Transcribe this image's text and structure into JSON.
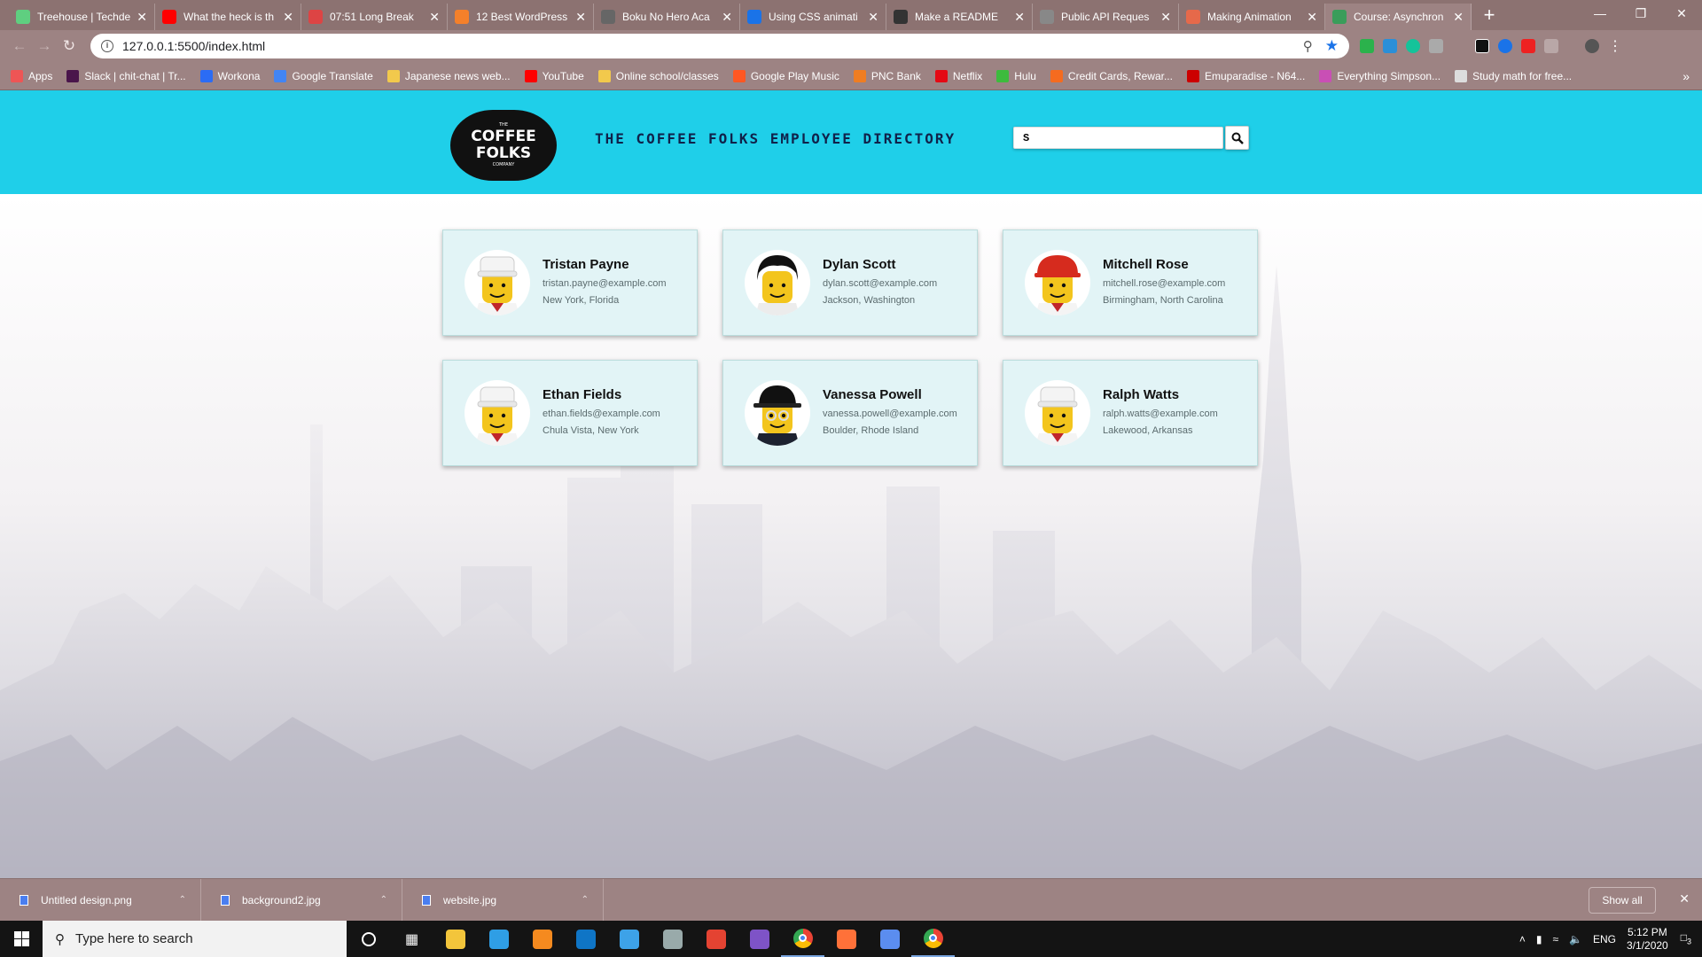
{
  "browser": {
    "tabs": [
      {
        "title": "Treehouse | Techde",
        "color": "#5fcf80"
      },
      {
        "title": "What the heck is th",
        "color": "#ff0000"
      },
      {
        "title": "07:51 Long Break",
        "color": "#d44"
      },
      {
        "title": "12 Best WordPress",
        "color": "#f4802a"
      },
      {
        "title": "Boku No Hero Aca",
        "color": "#666"
      },
      {
        "title": "Using CSS animati",
        "color": "#1a73e8"
      },
      {
        "title": "Make a README",
        "color": "#333"
      },
      {
        "title": "Public API Reques",
        "color": "#888"
      },
      {
        "title": "Making Animation",
        "color": "#e6694a"
      },
      {
        "title": "Course: Asynchron",
        "color": "#3a9d5a"
      }
    ],
    "new_tab": "+",
    "window_controls": {
      "minimize": "—",
      "restore": "❐",
      "close": "✕"
    },
    "url": "127.0.0.1:5500/index.html",
    "bookmarks": [
      {
        "label": "Apps",
        "color": "#e55"
      },
      {
        "label": "Slack | chit-chat | Tr...",
        "color": "#4a154b"
      },
      {
        "label": "Workona",
        "color": "#2b6cf5"
      },
      {
        "label": "Google Translate",
        "color": "#4285f4"
      },
      {
        "label": "Japanese news web...",
        "color": "#f2c94c"
      },
      {
        "label": "YouTube",
        "color": "#ff0000"
      },
      {
        "label": "Online school/classes",
        "color": "#f2c94c"
      },
      {
        "label": "Google Play Music",
        "color": "#ff5722"
      },
      {
        "label": "PNC Bank",
        "color": "#ef7d22"
      },
      {
        "label": "Netflix",
        "color": "#e50914"
      },
      {
        "label": "Hulu",
        "color": "#3dbb3d"
      },
      {
        "label": "Credit Cards, Rewar...",
        "color": "#f56b1f"
      },
      {
        "label": "Emuparadise - N64...",
        "color": "#c00"
      },
      {
        "label": "Everything Simpson...",
        "color": "#c94fb5"
      },
      {
        "label": "Study math for free...",
        "color": "#ddd"
      }
    ],
    "bookmarks_more": "»"
  },
  "site": {
    "logo_top": "THE",
    "logo_line1": "COFFEE",
    "logo_line2": "FOLKS",
    "logo_bottom": "COMPANY",
    "title": "THE COFFEE FOLKS EMPLOYEE DIRECTORY",
    "search_value": "S",
    "accent": "#1fcfe9"
  },
  "employees": [
    {
      "name": "Tristan Payne",
      "email": "tristan.payne@example.com",
      "location": "New York, Florida",
      "hat": "white",
      "hair": "#f4f4f4"
    },
    {
      "name": "Dylan Scott",
      "email": "dylan.scott@example.com",
      "location": "Jackson, Washington",
      "hat": "hair",
      "hair": "#111111"
    },
    {
      "name": "Mitchell Rose",
      "email": "mitchell.rose@example.com",
      "location": "Birmingham, North Carolina",
      "hat": "hardhat",
      "hair": "#d62b1e"
    },
    {
      "name": "Ethan Fields",
      "email": "ethan.fields@example.com",
      "location": "Chula Vista, New York",
      "hat": "white",
      "hair": "#f4f4f4"
    },
    {
      "name": "Vanessa Powell",
      "email": "vanessa.powell@example.com",
      "location": "Boulder, Rhode Island",
      "hat": "cap",
      "hair": "#111111"
    },
    {
      "name": "Ralph Watts",
      "email": "ralph.watts@example.com",
      "location": "Lakewood, Arkansas",
      "hat": "white",
      "hair": "#f4f4f4"
    }
  ],
  "downloads": {
    "items": [
      "Untitled design.png",
      "background2.jpg",
      "website.jpg"
    ],
    "show_all": "Show all"
  },
  "taskbar": {
    "search_placeholder": "Type here to search",
    "apps": [
      {
        "name": "cortana",
        "color": "#141414"
      },
      {
        "name": "task-view",
        "color": "#141414"
      },
      {
        "name": "file-explorer",
        "color": "#f3c53b"
      },
      {
        "name": "internet-explorer",
        "color": "#2f9ee5"
      },
      {
        "name": "sublime",
        "color": "#f58a1f"
      },
      {
        "name": "vscode",
        "color": "#0f75c6"
      },
      {
        "name": "firefox-dev",
        "color": "#3da2e8"
      },
      {
        "name": "app-gray",
        "color": "#9aa"
      },
      {
        "name": "todoist",
        "color": "#e44332"
      },
      {
        "name": "app-purple",
        "color": "#7e53c7"
      },
      {
        "name": "chrome",
        "color": "#e94a3c"
      },
      {
        "name": "firefox",
        "color": "#ff7139"
      },
      {
        "name": "maps",
        "color": "#5b8def"
      },
      {
        "name": "chrome-2",
        "color": "#e94a3c"
      }
    ],
    "language": "ENG",
    "time": "5:12 PM",
    "date": "3/1/2020",
    "notifications": "3"
  }
}
